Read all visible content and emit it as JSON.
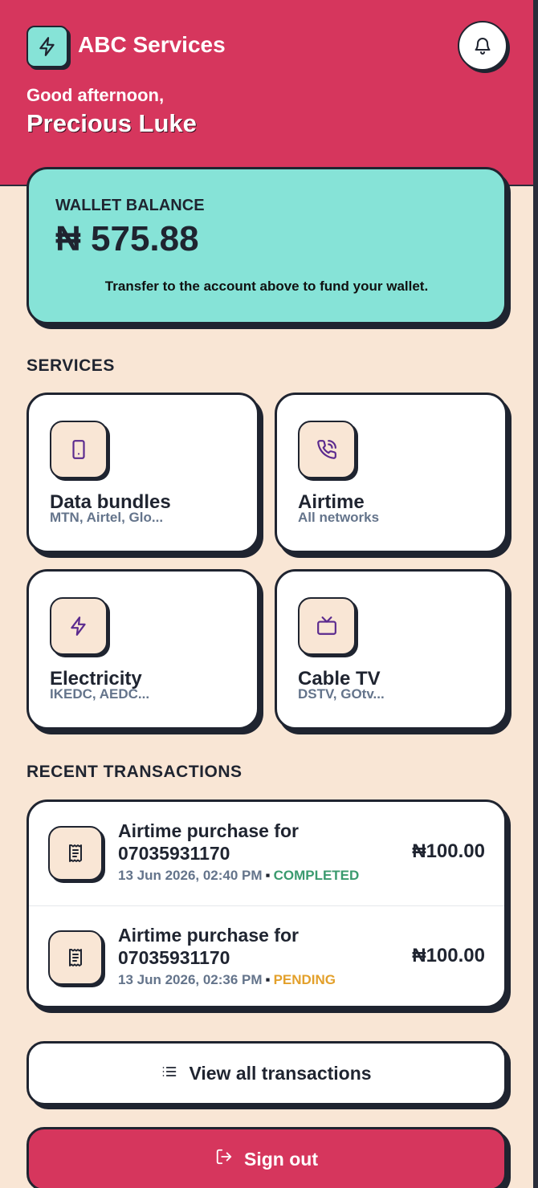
{
  "header": {
    "brand": "ABC Services",
    "greeting": "Good afternoon,",
    "user_name": "Precious Luke",
    "icons": {
      "logo": "lightning-icon",
      "notifications": "bell-icon"
    }
  },
  "wallet": {
    "label": "WALLET BALANCE",
    "amount": "₦ 575.88",
    "note": "Transfer to the account above to fund your wallet."
  },
  "services": {
    "title": "SERVICES",
    "items": [
      {
        "title": "Data bundles",
        "subtitle": "MTN, Airtel, Glo...",
        "icon": "phone-icon"
      },
      {
        "title": "Airtime",
        "subtitle": "All networks",
        "icon": "phone-call-icon"
      },
      {
        "title": "Electricity",
        "subtitle": "IKEDC, AEDC...",
        "icon": "lightning-icon"
      },
      {
        "title": "Cable TV",
        "subtitle": "DSTV, GOtv...",
        "icon": "tv-icon"
      }
    ]
  },
  "transactions": {
    "title": "RECENT TRANSACTIONS",
    "items": [
      {
        "title": "Airtime purchase for 07035931170",
        "date": "13 Jun 2026, 02:40 PM",
        "status": "COMPLETED",
        "amount": "₦100.00",
        "status_color": "#3a9a6e"
      },
      {
        "title": "Airtime purchase for 07035931170",
        "date": "13 Jun 2026, 02:36 PM",
        "status": "PENDING",
        "amount": "₦100.00",
        "status_color": "#e3a02b"
      }
    ]
  },
  "actions": {
    "view_all": "View all transactions",
    "sign_out": "Sign out"
  },
  "colors": {
    "primary": "#d6365d",
    "accent": "#86e3d7",
    "background": "#f9e6d5",
    "icon": "#5b2a8e"
  }
}
